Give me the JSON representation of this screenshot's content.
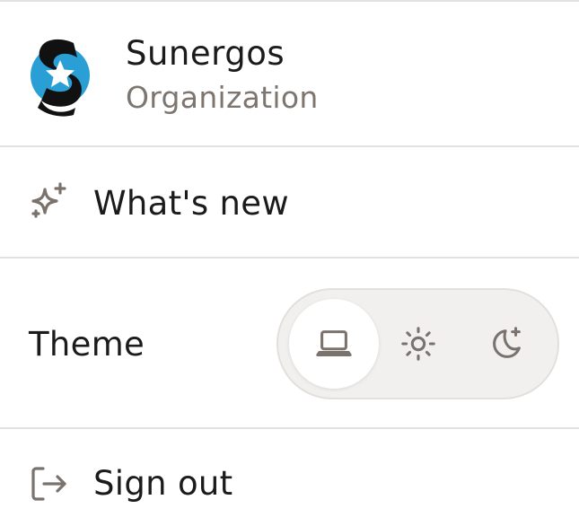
{
  "org": {
    "name": "Sunergos",
    "type": "Organization",
    "logo_icon": "sunergos-logo-icon",
    "logo_colors": {
      "circle": "#2a9fd6",
      "s": "#111111",
      "star": "#ffffff"
    }
  },
  "menu": {
    "whats_new": {
      "label": "What's new",
      "icon": "sparkles-icon"
    },
    "theme": {
      "label": "Theme",
      "options": [
        {
          "id": "system",
          "icon": "laptop-icon",
          "selected": true
        },
        {
          "id": "light",
          "icon": "sun-icon",
          "selected": false
        },
        {
          "id": "dark",
          "icon": "moon-icon",
          "selected": false
        }
      ]
    },
    "sign_out": {
      "label": "Sign out",
      "icon": "sign-out-icon"
    }
  },
  "colors": {
    "icon": "#7a726c",
    "text": "#1b1b1b",
    "muted": "#7d756f",
    "divider": "#e3e1de",
    "switch_bg": "#f1f0ef"
  }
}
